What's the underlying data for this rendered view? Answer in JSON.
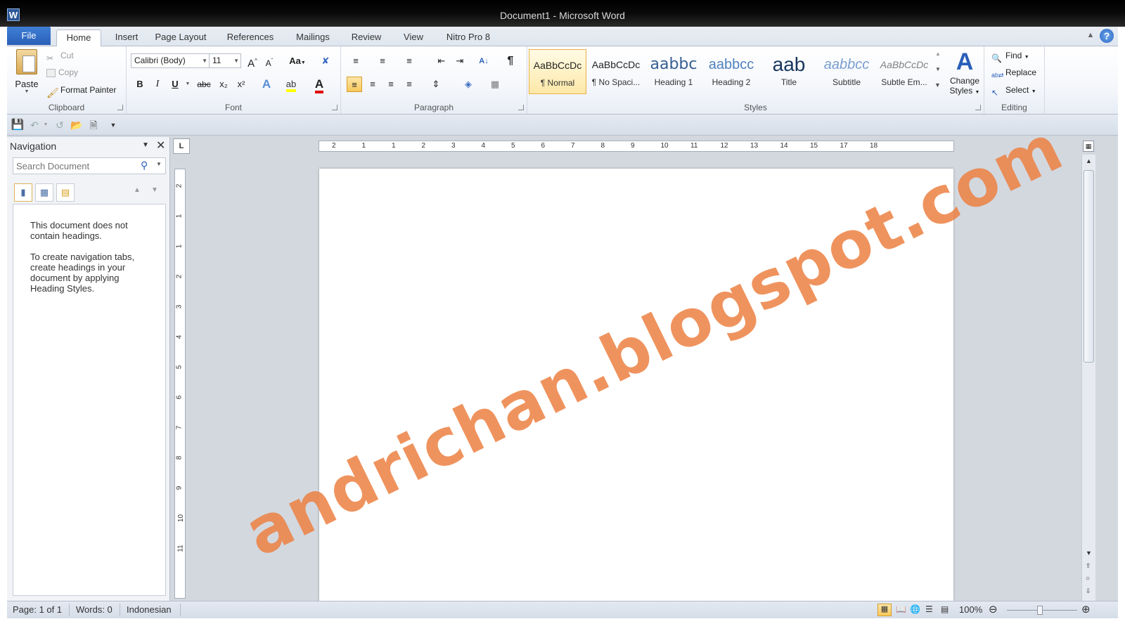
{
  "window": {
    "title": "Document1  -  Microsoft Word",
    "app_icon": "W"
  },
  "tabs": [
    {
      "label": "File"
    },
    {
      "label": "Home"
    },
    {
      "label": "Insert"
    },
    {
      "label": "Page Layout"
    },
    {
      "label": "References"
    },
    {
      "label": "Mailings"
    },
    {
      "label": "Review"
    },
    {
      "label": "View"
    },
    {
      "label": "Nitro Pro 8"
    }
  ],
  "ribbon": {
    "clipboard": {
      "label": "Clipboard",
      "paste": "Paste",
      "cut": "Cut",
      "copy": "Copy",
      "format_painter": "Format Painter"
    },
    "font": {
      "label": "Font",
      "font_name": "Calibri (Body)",
      "font_size": "11",
      "change_case": "Aa",
      "bold": "B",
      "italic": "I",
      "underline": "U",
      "strike": "abc",
      "subscript": "x₂",
      "superscript": "x²"
    },
    "paragraph": {
      "label": "Paragraph",
      "pilcrow": "¶"
    },
    "styles": {
      "label": "Styles",
      "items": [
        {
          "preview": "AaBbCcDc",
          "name": "¶ Normal"
        },
        {
          "preview": "AaBbCcDc",
          "name": "¶ No Spaci..."
        },
        {
          "preview": "aabbc",
          "name": "Heading 1"
        },
        {
          "preview": "aabbcc",
          "name": "Heading 2"
        },
        {
          "preview": "aab",
          "name": "Title"
        },
        {
          "preview": "aabbcc",
          "name": "Subtitle"
        },
        {
          "preview": "AaBbCcDc",
          "name": "Subtle Em..."
        }
      ],
      "change_styles_line1": "Change",
      "change_styles_line2": "Styles"
    },
    "editing": {
      "label": "Editing",
      "find": "Find",
      "replace": "Replace",
      "select": "Select"
    }
  },
  "navigation": {
    "title": "Navigation",
    "search_placeholder": "Search Document",
    "message1": "This document does not contain headings.",
    "message2": "To create navigation tabs, create headings in your document by applying Heading Styles."
  },
  "ruler": {
    "horizontal": [
      "2",
      "1",
      "1",
      "2",
      "3",
      "4",
      "5",
      "6",
      "7",
      "8",
      "9",
      "10",
      "11",
      "12",
      "13",
      "14",
      "15",
      "17",
      "18"
    ],
    "vertical": [
      "2",
      "1",
      "1",
      "2",
      "3",
      "4",
      "5",
      "6",
      "7",
      "8",
      "9",
      "10",
      "11"
    ]
  },
  "watermark": "andrichan.blogspot.com",
  "status": {
    "page": "Page: 1 of 1",
    "words": "Words: 0",
    "language": "Indonesian",
    "zoom": "100%"
  },
  "colors": {
    "accent": "#2a5fb8",
    "watermark": "#ec8042",
    "selected_style": "#e9b04a"
  }
}
